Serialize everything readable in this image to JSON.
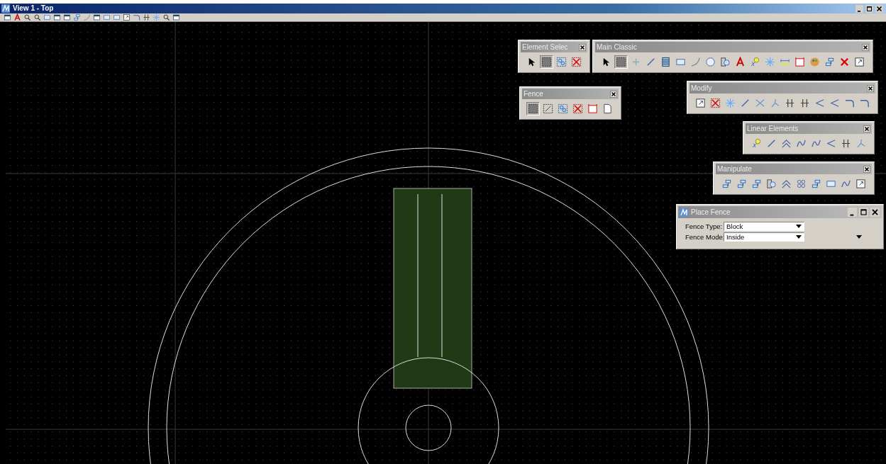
{
  "window": {
    "title": "View 1 - Top"
  },
  "view_toolbar": {
    "tools": [
      {
        "selected": false
      },
      {
        "selected": false
      },
      {
        "selected": false
      },
      {
        "selected": false
      },
      {
        "selected": false
      },
      {
        "selected": false
      },
      {
        "selected": false
      },
      {
        "selected": false
      },
      {
        "selected": false
      },
      {
        "selected": false
      },
      {
        "selected": false
      },
      {
        "selected": false
      },
      {
        "selected": false
      },
      {
        "selected": false
      },
      {
        "selected": false
      },
      {
        "selected": false
      },
      {
        "selected": false
      },
      {
        "selected": false
      }
    ]
  },
  "tool_palettes": [
    {
      "kind": "element-selection",
      "title": "Element Selec",
      "tools": [
        {
          "selected": false
        },
        {
          "selected": true
        },
        {
          "selected": false
        },
        {
          "selected": false
        }
      ]
    },
    {
      "kind": "main-classic",
      "title": "Main Classic",
      "tools": [
        {
          "selected": false
        },
        {
          "selected": true
        },
        {
          "selected": false
        },
        {
          "selected": false
        },
        {
          "selected": false
        },
        {
          "selected": false
        },
        {
          "selected": false
        },
        {
          "selected": false
        },
        {
          "selected": false
        },
        {
          "selected": false
        },
        {
          "selected": false
        },
        {
          "selected": false
        },
        {
          "selected": false
        },
        {
          "selected": false
        },
        {
          "selected": false
        },
        {
          "selected": false
        },
        {
          "selected": false
        },
        {
          "selected": false
        }
      ]
    },
    {
      "kind": "fence",
      "title": "Fence",
      "tools": [
        {
          "selected": true
        },
        {
          "selected": false
        },
        {
          "selected": false
        },
        {
          "selected": false
        },
        {
          "selected": false
        },
        {
          "selected": false
        }
      ]
    },
    {
      "kind": "modify",
      "title": "Modify",
      "tools": [
        {
          "selected": false
        },
        {
          "selected": false
        },
        {
          "selected": false
        },
        {
          "selected": false
        },
        {
          "selected": false
        },
        {
          "selected": false
        },
        {
          "selected": false
        },
        {
          "selected": false
        },
        {
          "selected": false
        },
        {
          "selected": false
        },
        {
          "selected": false
        },
        {
          "selected": false
        }
      ]
    },
    {
      "kind": "linear-elements",
      "title": "Linear Elements",
      "tools": [
        {
          "selected": false
        },
        {
          "selected": false
        },
        {
          "selected": false
        },
        {
          "selected": false
        },
        {
          "selected": false
        },
        {
          "selected": false
        },
        {
          "selected": false
        },
        {
          "selected": false
        }
      ]
    },
    {
      "kind": "manipulate",
      "title": "Manipulate",
      "tools": [
        {
          "selected": false
        },
        {
          "selected": false
        },
        {
          "selected": false
        },
        {
          "selected": false
        },
        {
          "selected": false
        },
        {
          "selected": false
        },
        {
          "selected": false
        },
        {
          "selected": false
        },
        {
          "selected": false
        },
        {
          "selected": false
        }
      ]
    }
  ],
  "place_fence": {
    "title": "Place Fence",
    "fields": [
      {
        "label": "Fence Type:",
        "value": "Block"
      },
      {
        "label": "Fence Mode:",
        "value": "Inside"
      }
    ]
  }
}
